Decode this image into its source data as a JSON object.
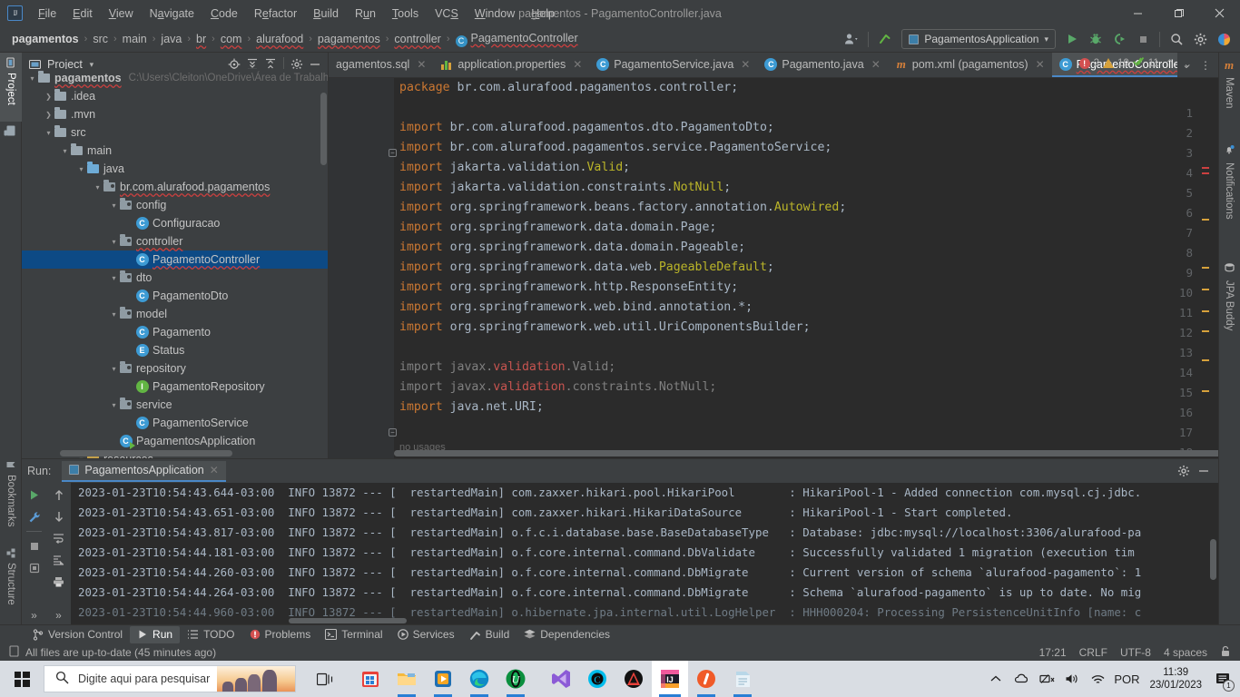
{
  "window": {
    "title": "pagamentos - PagamentoController.java",
    "minimize": "—",
    "maximize": "❐",
    "close": "✕"
  },
  "menu": {
    "items": [
      "File",
      "Edit",
      "View",
      "Navigate",
      "Code",
      "Refactor",
      "Build",
      "Run",
      "Tools",
      "VCS",
      "Window",
      "Help"
    ]
  },
  "breadcrumb": {
    "items": [
      "pagamentos",
      "src",
      "main",
      "java",
      "br",
      "com",
      "alurafood",
      "pagamentos",
      "controller",
      "PagamentoController"
    ],
    "separator": "›",
    "class_badge": "C"
  },
  "toolbar": {
    "run_config": "PagamentosApplication",
    "dropdown_caret": "▾",
    "run_label": "Run",
    "debug_label": "Debug",
    "run_with_coverage_label": "Run with Coverage",
    "stop_label": "Stop",
    "search_label": "Search Everywhere",
    "settings_label": "Settings",
    "updates_label": "Updates"
  },
  "left_strip": {
    "project": "Project",
    "bookmarks": "Bookmarks",
    "structure": "Structure"
  },
  "right_strip": {
    "maven": "Maven",
    "notifications": "Notifications",
    "jpa_buddy": "JPA Buddy"
  },
  "project_panel": {
    "title": "Project",
    "caret": "▾",
    "icons": [
      "locate-icon",
      "expand-all-icon",
      "collapse-all-icon",
      "gear-icon",
      "hide-icon"
    ],
    "tree": [
      {
        "label": "pagamentos",
        "path": "C:\\Users\\Cleiton\\OneDrive\\Área de Trabalh",
        "indent": 0,
        "arrow": "▾",
        "icon": "module-folder",
        "bold": true,
        "squiggle": true,
        "selected": false
      },
      {
        "label": ".idea",
        "indent": 1,
        "arrow": "❯",
        "icon": "folder",
        "selected": false
      },
      {
        "label": ".mvn",
        "indent": 1,
        "arrow": "❯",
        "icon": "folder",
        "selected": false
      },
      {
        "label": "src",
        "indent": 1,
        "arrow": "▾",
        "icon": "folder",
        "selected": false
      },
      {
        "label": "main",
        "indent": 2,
        "arrow": "▾",
        "icon": "folder",
        "selected": false
      },
      {
        "label": "java",
        "indent": 3,
        "arrow": "▾",
        "icon": "folder-src",
        "selected": false
      },
      {
        "label": "br.com.alurafood.pagamentos",
        "indent": 4,
        "arrow": "▾",
        "icon": "folder-pkg",
        "squiggle": true,
        "selected": false
      },
      {
        "label": "config",
        "indent": 5,
        "arrow": "▾",
        "icon": "folder-pkg",
        "selected": false
      },
      {
        "label": "Configuracao",
        "indent": 6,
        "arrow": "",
        "icon": "class",
        "badge": "C",
        "selected": false
      },
      {
        "label": "controller",
        "indent": 5,
        "arrow": "▾",
        "icon": "folder-pkg",
        "squiggle": true,
        "selected": false
      },
      {
        "label": "PagamentoController",
        "indent": 6,
        "arrow": "",
        "icon": "class",
        "badge": "C",
        "squiggle": true,
        "selected": true
      },
      {
        "label": "dto",
        "indent": 5,
        "arrow": "▾",
        "icon": "folder-pkg",
        "selected": false
      },
      {
        "label": "PagamentoDto",
        "indent": 6,
        "arrow": "",
        "icon": "class",
        "badge": "C",
        "selected": false
      },
      {
        "label": "model",
        "indent": 5,
        "arrow": "▾",
        "icon": "folder-pkg",
        "selected": false
      },
      {
        "label": "Pagamento",
        "indent": 6,
        "arrow": "",
        "icon": "class",
        "badge": "C",
        "selected": false
      },
      {
        "label": "Status",
        "indent": 6,
        "arrow": "",
        "icon": "enum",
        "badge": "E",
        "selected": false
      },
      {
        "label": "repository",
        "indent": 5,
        "arrow": "▾",
        "icon": "folder-pkg",
        "selected": false
      },
      {
        "label": "PagamentoRepository",
        "indent": 6,
        "arrow": "",
        "icon": "interface",
        "badge": "I",
        "selected": false
      },
      {
        "label": "service",
        "indent": 5,
        "arrow": "▾",
        "icon": "folder-pkg",
        "selected": false
      },
      {
        "label": "PagamentoService",
        "indent": 6,
        "arrow": "",
        "icon": "class",
        "badge": "C",
        "selected": false
      },
      {
        "label": "PagamentosApplication",
        "indent": 5,
        "arrow": "",
        "icon": "class-runnable",
        "badge": "C",
        "selected": false
      },
      {
        "label": "resources",
        "indent": 3,
        "arrow": "▾",
        "icon": "folder-res",
        "selected": false
      }
    ]
  },
  "editor_tabs": [
    {
      "label": "agamentos.sql",
      "icon": "sql-file-icon",
      "active": false,
      "truncated": true
    },
    {
      "label": "application.properties",
      "icon": "properties-file-icon",
      "active": false
    },
    {
      "label": "PagamentoService.java",
      "icon": "java-class-icon",
      "badge": "C",
      "active": false
    },
    {
      "label": "Pagamento.java",
      "icon": "java-class-icon",
      "badge": "C",
      "active": false
    },
    {
      "label": "pom.xml (pagamentos)",
      "icon": "maven-file-icon",
      "badge": "m",
      "active": false
    },
    {
      "label": "PagamentoController.java",
      "icon": "java-class-icon",
      "badge": "C",
      "active": true,
      "squiggle": true
    }
  ],
  "editor_tabs_controls": {
    "list_caret": "⌄",
    "more": "⋮"
  },
  "inspections": {
    "errors": "2",
    "warnings": "10",
    "ok": "11",
    "up": "⌃",
    "down": "⌄"
  },
  "code": {
    "lines": [
      {
        "n": "1",
        "tokens": [
          {
            "t": "package ",
            "c": "kw"
          },
          {
            "t": "br.com.alurafood.pagamentos.controller;",
            "c": "id"
          }
        ]
      },
      {
        "n": "2",
        "tokens": []
      },
      {
        "n": "3",
        "fold": "minus",
        "tokens": [
          {
            "t": "import ",
            "c": "kw"
          },
          {
            "t": "br.com.alurafood.pagamentos.dto.PagamentoDto;",
            "c": "id"
          }
        ]
      },
      {
        "n": "4",
        "tokens": [
          {
            "t": "import ",
            "c": "kw"
          },
          {
            "t": "br.com.alurafood.pagamentos.service.PagamentoService;",
            "c": "id"
          }
        ]
      },
      {
        "n": "5",
        "tokens": [
          {
            "t": "import ",
            "c": "kw"
          },
          {
            "t": "jakarta.validation.",
            "c": "id"
          },
          {
            "t": "Valid",
            "c": "ann"
          },
          {
            "t": ";",
            "c": "id"
          }
        ]
      },
      {
        "n": "6",
        "tokens": [
          {
            "t": "import ",
            "c": "kw"
          },
          {
            "t": "jakarta.validation.constraints.",
            "c": "id"
          },
          {
            "t": "NotNull",
            "c": "ann"
          },
          {
            "t": ";",
            "c": "id"
          }
        ]
      },
      {
        "n": "7",
        "tokens": [
          {
            "t": "import ",
            "c": "kw"
          },
          {
            "t": "org.springframework.beans.factory.annotation.",
            "c": "id"
          },
          {
            "t": "Autowired",
            "c": "ann"
          },
          {
            "t": ";",
            "c": "id"
          }
        ]
      },
      {
        "n": "8",
        "tokens": [
          {
            "t": "import ",
            "c": "kw"
          },
          {
            "t": "org.springframework.data.domain.Page;",
            "c": "id"
          }
        ]
      },
      {
        "n": "9",
        "tokens": [
          {
            "t": "import ",
            "c": "kw"
          },
          {
            "t": "org.springframework.data.domain.Pageable;",
            "c": "id"
          }
        ]
      },
      {
        "n": "10",
        "tokens": [
          {
            "t": "import ",
            "c": "kw"
          },
          {
            "t": "org.springframework.data.web.",
            "c": "id"
          },
          {
            "t": "PageableDefault",
            "c": "ann"
          },
          {
            "t": ";",
            "c": "id"
          }
        ]
      },
      {
        "n": "11",
        "tokens": [
          {
            "t": "import ",
            "c": "kw"
          },
          {
            "t": "org.springframework.http.ResponseEntity;",
            "c": "id"
          }
        ]
      },
      {
        "n": "12",
        "tokens": [
          {
            "t": "import ",
            "c": "kw"
          },
          {
            "t": "org.springframework.web.bind.annotation.*;",
            "c": "id"
          }
        ]
      },
      {
        "n": "13",
        "tokens": [
          {
            "t": "import ",
            "c": "kw"
          },
          {
            "t": "org.springframework.web.util.UriComponentsBuilder;",
            "c": "id"
          }
        ]
      },
      {
        "n": "14",
        "tokens": []
      },
      {
        "n": "15",
        "tokens": [
          {
            "t": "import ",
            "c": "dim"
          },
          {
            "t": "javax.",
            "c": "dim"
          },
          {
            "t": "validation",
            "c": "dimred"
          },
          {
            "t": ".Valid;",
            "c": "dim"
          }
        ]
      },
      {
        "n": "16",
        "tokens": [
          {
            "t": "import ",
            "c": "dim"
          },
          {
            "t": "javax.",
            "c": "dim"
          },
          {
            "t": "validation",
            "c": "dimred"
          },
          {
            "t": ".constraints.NotNull;",
            "c": "dim"
          }
        ]
      },
      {
        "n": "17",
        "fold": "minus",
        "tokens": [
          {
            "t": "import ",
            "c": "kw"
          },
          {
            "t": "java.net.URI;",
            "c": "id"
          }
        ]
      },
      {
        "n": "18",
        "tokens": []
      }
    ],
    "hint": "no usages"
  },
  "run_panel": {
    "label": "Run:",
    "tab": "PagamentosApplication",
    "close": "✕",
    "gear": "gear-icon",
    "hide": "—",
    "tools": [
      "rerun-icon",
      "wrench-icon",
      "stop-icon",
      "dump-icon",
      "scroll-up-icon",
      "scroll-down-icon",
      "soft-wrap-icon",
      "scroll-to-end-icon",
      "print-icon",
      "expand-left-icon",
      "expand-right-icon"
    ],
    "console_lines": [
      "2023-01-23T10:54:43.644-03:00  INFO 13872 --- [  restartedMain] com.zaxxer.hikari.pool.HikariPool        : HikariPool-1 - Added connection com.mysql.cj.jdbc.",
      "2023-01-23T10:54:43.651-03:00  INFO 13872 --- [  restartedMain] com.zaxxer.hikari.HikariDataSource       : HikariPool-1 - Start completed.",
      "2023-01-23T10:54:43.817-03:00  INFO 13872 --- [  restartedMain] o.f.c.i.database.base.BaseDatabaseType   : Database: jdbc:mysql://localhost:3306/alurafood-pa",
      "2023-01-23T10:54:44.181-03:00  INFO 13872 --- [  restartedMain] o.f.core.internal.command.DbValidate     : Successfully validated 1 migration (execution tim",
      "2023-01-23T10:54:44.260-03:00  INFO 13872 --- [  restartedMain] o.f.core.internal.command.DbMigrate      : Current version of schema `alurafood-pagamento`: 1",
      "2023-01-23T10:54:44.264-03:00  INFO 13872 --- [  restartedMain] o.f.core.internal.command.DbMigrate      : Schema `alurafood-pagamento` is up to date. No mig",
      "2023-01-23T10:54:44.960-03:00  INFO 13872 --- [  restartedMain] o.hibernate.jpa.internal.util.LogHelper  : HHH000204: Processing PersistenceUnitInfo [name: c"
    ]
  },
  "tool_window_bar": [
    {
      "label": "Version Control",
      "icon": "branch-icon",
      "selected": false
    },
    {
      "label": "Run",
      "icon": "play-icon",
      "selected": true
    },
    {
      "label": "TODO",
      "icon": "list-icon",
      "selected": false
    },
    {
      "label": "Problems",
      "icon": "error-icon",
      "selected": false
    },
    {
      "label": "Terminal",
      "icon": "terminal-icon",
      "selected": false
    },
    {
      "label": "Services",
      "icon": "services-icon",
      "selected": false
    },
    {
      "label": "Build",
      "icon": "hammer-icon",
      "selected": false
    },
    {
      "label": "Dependencies",
      "icon": "layers-icon",
      "selected": false
    }
  ],
  "status_bar": {
    "message": "All files are up-to-date (45 minutes ago)",
    "caret_position": "17:21",
    "line_separator": "CRLF",
    "encoding": "UTF-8",
    "indent": "4 spaces",
    "lock": "read-only-toggle-icon"
  },
  "taskbar": {
    "search_placeholder": "Digite aqui para pesquisar",
    "icons": [
      {
        "name": "task-view-icon"
      },
      {
        "name": "microsoft-store-icon"
      },
      {
        "name": "file-explorer-icon"
      },
      {
        "name": "media-player-icon"
      },
      {
        "name": "microsoft-edge-icon"
      },
      {
        "name": "opera-icon"
      },
      {
        "name": "visual-studio-icon"
      },
      {
        "name": "cisco-webex-icon"
      },
      {
        "name": "avast-icon"
      },
      {
        "name": "intellij-idea-icon"
      },
      {
        "name": "opera-gx-icon"
      },
      {
        "name": "notepad-icon"
      }
    ],
    "tray": {
      "chevron": "⌃",
      "language": "POR",
      "time": "11:39",
      "date": "23/01/2023",
      "notification_count": "1"
    }
  },
  "colors": {
    "accent": "#4a88c7",
    "panel_bg": "#3c3f41",
    "editor_bg": "#2b2b2b",
    "selection": "#0d4a85",
    "keyword": "#cc7832",
    "annotation": "#bbb529",
    "identifier": "#a9b7c6",
    "error_red": "#d35050",
    "warning_yellow": "#d6a13b",
    "green": "#62b543"
  }
}
